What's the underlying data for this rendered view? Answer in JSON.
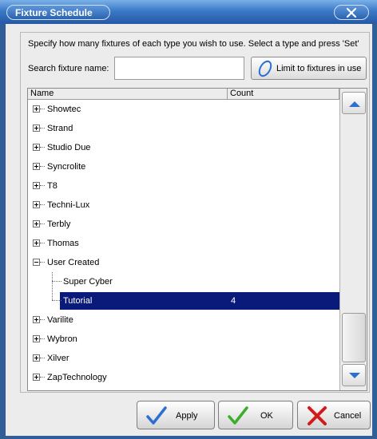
{
  "window": {
    "title": "Fixture Schedule"
  },
  "instructions": "Specify how many fixtures of each type you wish to use.  Select a type and press 'Set'",
  "search": {
    "label": "Search fixture name:",
    "value": "",
    "limit_button_label": "Limit to fixtures in use"
  },
  "list": {
    "columns": [
      "Name",
      "Count"
    ],
    "rows": [
      {
        "label": "Showtec",
        "expanded": false
      },
      {
        "label": "Strand",
        "expanded": false
      },
      {
        "label": "Studio Due",
        "expanded": false
      },
      {
        "label": "Syncrolite",
        "expanded": false
      },
      {
        "label": "T8",
        "expanded": false
      },
      {
        "label": "Techni-Lux",
        "expanded": false
      },
      {
        "label": "Terbly",
        "expanded": false
      },
      {
        "label": "Thomas",
        "expanded": false
      },
      {
        "label": "User Created",
        "expanded": true
      },
      {
        "label": "Super Cyber",
        "child": true
      },
      {
        "label": "Tutorial",
        "child": true,
        "selected": true,
        "count": "4"
      },
      {
        "label": "Varilite",
        "expanded": false
      },
      {
        "label": "Wybron",
        "expanded": false
      },
      {
        "label": "Xilver",
        "expanded": false
      },
      {
        "label": "ZapTechnology",
        "expanded": false
      }
    ],
    "scroll_position": 0.85
  },
  "buttons": {
    "apply": "Apply",
    "ok": "OK",
    "cancel": "Cancel"
  },
  "colors": {
    "titlebar": "#3b7ac6",
    "selection": "#0a1a7a",
    "accent_check": "#2d6fd0",
    "cancel_x": "#d21a1a",
    "ok_check": "#3cae2a"
  }
}
